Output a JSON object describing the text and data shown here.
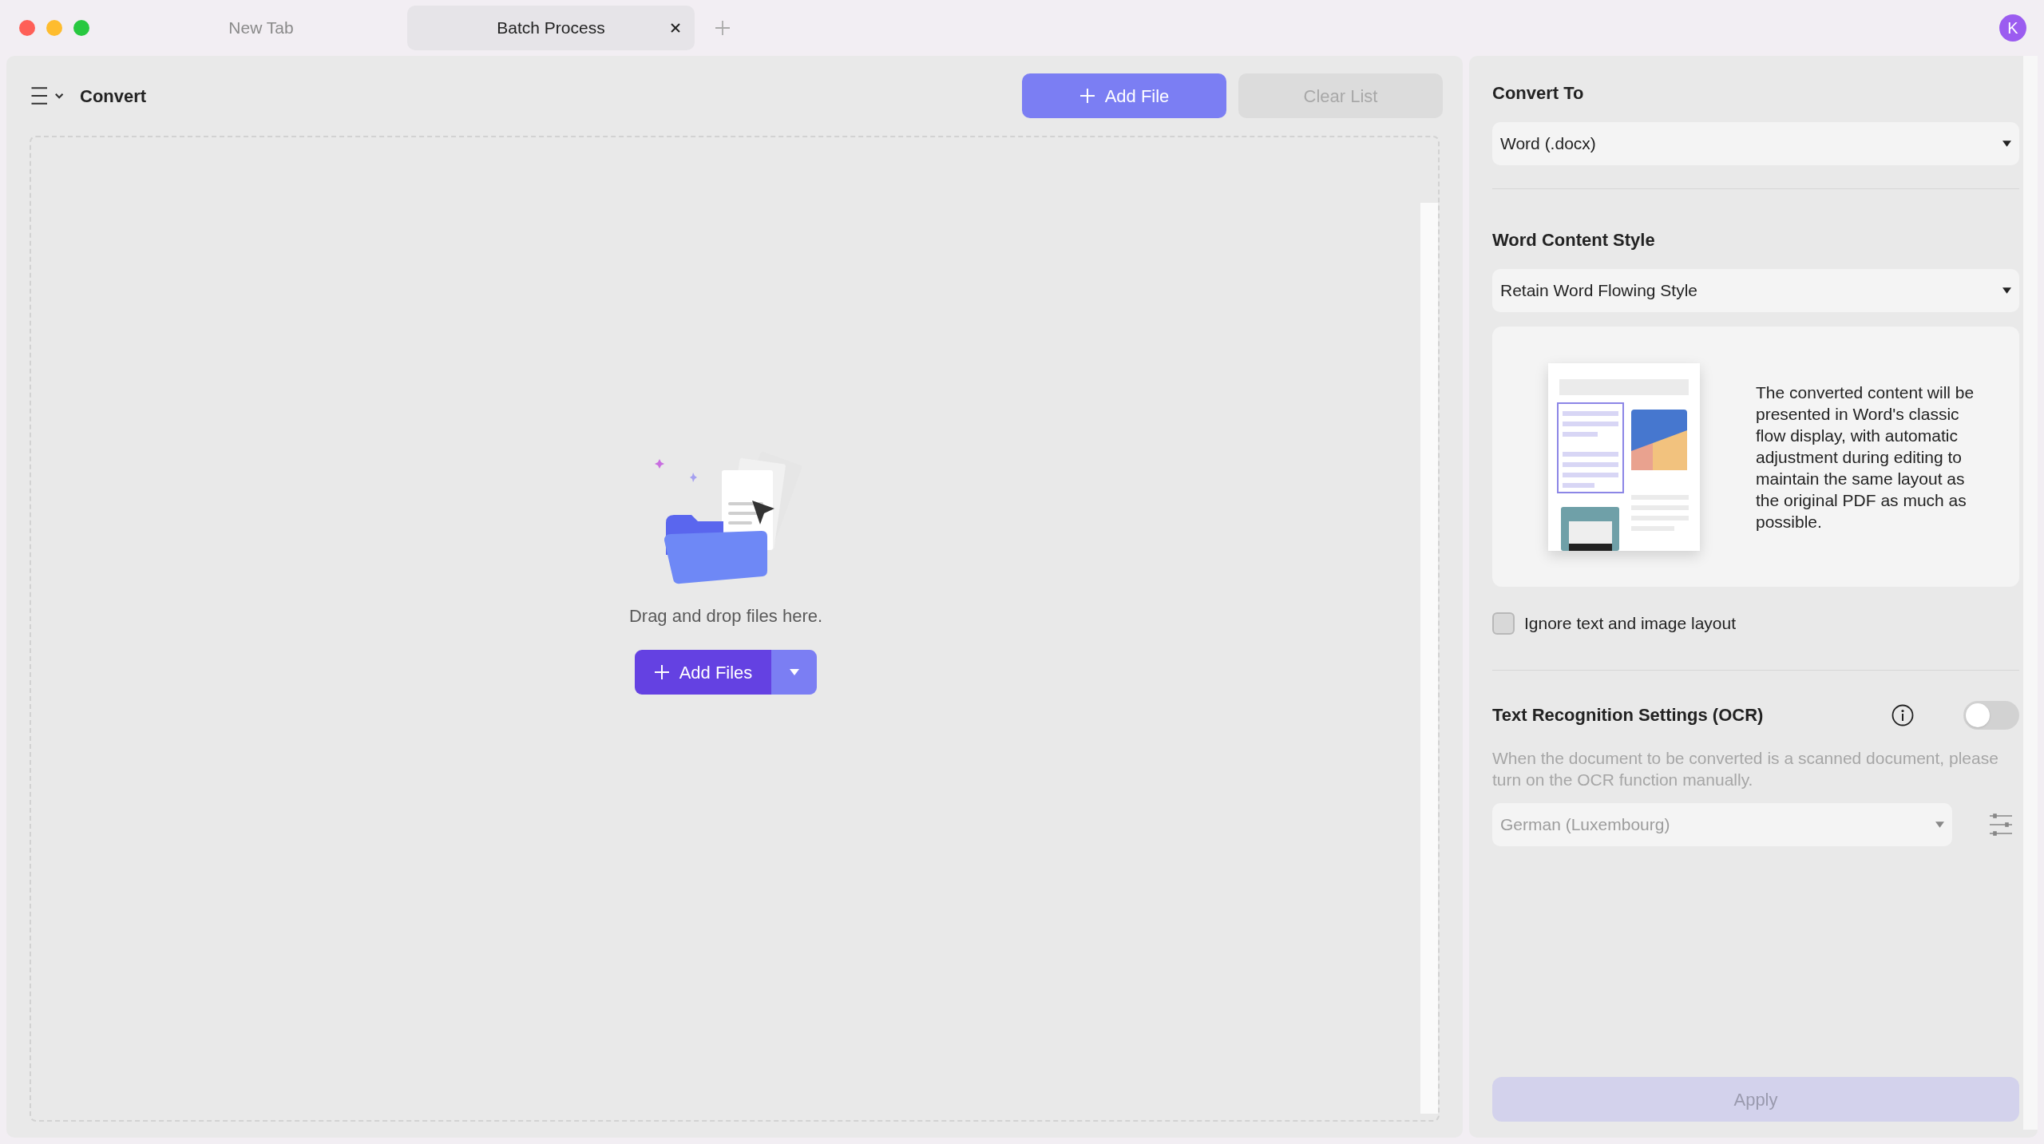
{
  "window": {
    "tabs": [
      {
        "label": "New Tab",
        "selected": false
      },
      {
        "label": "Batch Process",
        "selected": true
      }
    ],
    "avatar": "K"
  },
  "toolbar": {
    "title": "Convert",
    "buttons": [
      {
        "label": "Add File",
        "disabled": false
      },
      {
        "label": "Clear List",
        "disabled": true
      }
    ]
  },
  "dropzone": {
    "hint": "Drag and drop files here.",
    "button": {
      "label": "Add Files"
    }
  },
  "settings": {
    "convert_to": {
      "label": "Convert To",
      "value": "Word (.docx)"
    },
    "content_style": {
      "label": "Word Content Style",
      "value": "Retain Word Flowing Style",
      "description": "The converted content will be presented in Word's classic flow display, with automatic adjustment during editing to maintain the same layout as the original PDF as much as possible."
    },
    "ignore_layout": {
      "label": "Ignore text and image layout",
      "checked": false
    },
    "ocr": {
      "label": "Text Recognition Settings (OCR)",
      "on": false,
      "description": "When the document to be converted is a scanned document, please turn on the OCR function manually.",
      "language": "German (Luxembourg)",
      "disabled": true
    },
    "apply": {
      "label": "Apply",
      "disabled": true
    }
  }
}
